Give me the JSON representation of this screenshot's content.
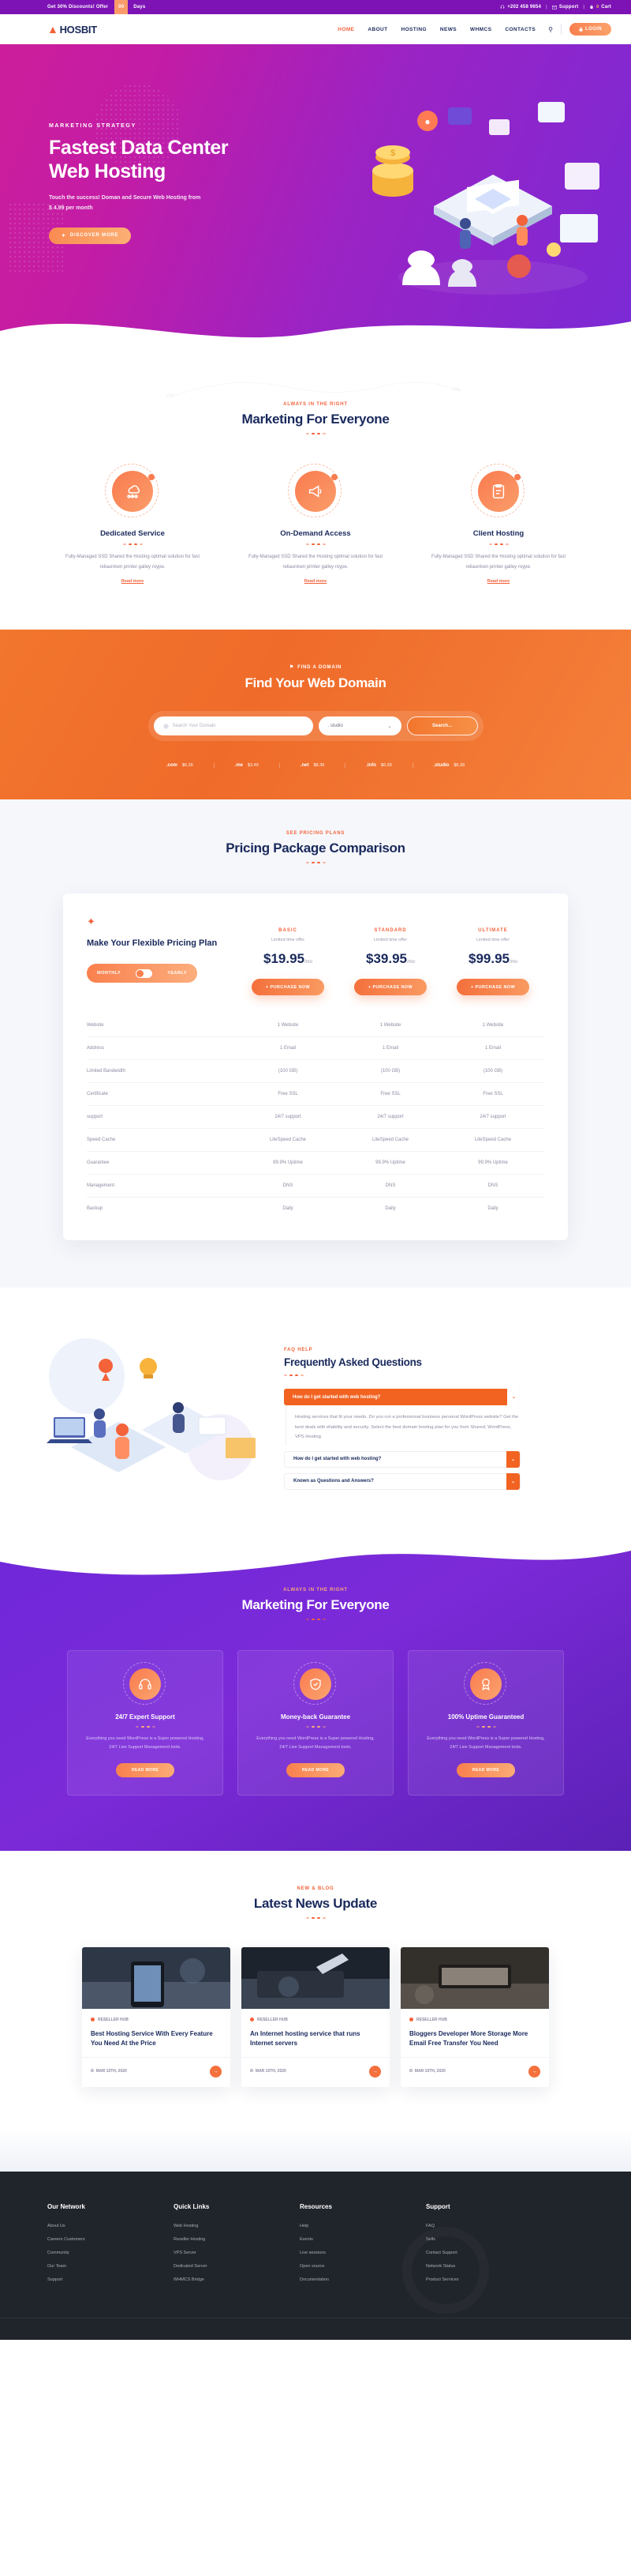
{
  "topbar": {
    "offer_text": "Get 30% Discounts! Offer",
    "counter": "00",
    "days_label": "Days",
    "phone": "+202 458 9654",
    "support": "Support",
    "cart": "Cart",
    "cart_count": "0",
    "bg_color": "#7d13b5",
    "counter_color": "#fb9b6a"
  },
  "nav": {
    "logo": "HOSBIT",
    "items": [
      {
        "label": "HOME",
        "active": true
      },
      {
        "label": "ABOUT",
        "active": false
      },
      {
        "label": "HOSTING",
        "active": false
      },
      {
        "label": "NEWS",
        "active": false
      },
      {
        "label": "WHMCS",
        "active": false
      },
      {
        "label": "CONTACTS",
        "active": false
      }
    ],
    "login_label": "LOGIN",
    "accent_color": "#f4623a"
  },
  "hero": {
    "eyebrow": "MARKETING STRATEGY",
    "title_line1": "Fastest Data Center",
    "title_line2": "Web Hosting",
    "sub_line1": "Touch the success! Doman and Secure Web Hosting from",
    "sub_line2": "$ 4.99 per month",
    "cta": "DISCOVER MORE"
  },
  "services": {
    "eyebrow": "ALWAYS IN THE RIGHT",
    "title": "Marketing For Everyone",
    "items": [
      {
        "icon": "cloud-network-icon",
        "title": "Dedicated Service",
        "desc": "Fully-Managed SSD Shared the Hosting optimal solution for fast reliaunkwn printer galley roype.",
        "link": "Read more"
      },
      {
        "icon": "megaphone-icon",
        "title": "On-Demand Access",
        "desc": "Fully-Managed SSD Shared the Hosting optimal solution for fast reliaunkwn printer galley roype.",
        "link": "Read more"
      },
      {
        "icon": "clipboard-icon",
        "title": "Client Hosting",
        "desc": "Fully-Managed SSD Shared the Hosting optimal solution for fast reliaunkwn printer galley roype.",
        "link": "Read more"
      }
    ]
  },
  "domain": {
    "eyebrow": "FIND A DOMAIN",
    "title": "Find Your Web Domain",
    "search_placeholder": "Search Your Domain",
    "tld_selected": ". studio",
    "search_button": "Search...",
    "tlds": [
      {
        "name": ".com",
        "price": "$6.39"
      },
      {
        "name": ".me",
        "price": "$3.49"
      },
      {
        "name": ".net",
        "price": "$8.39"
      },
      {
        "name": ".info",
        "price": "$6.39"
      },
      {
        "name": ".studio",
        "price": "$6.39"
      }
    ]
  },
  "pricing": {
    "eyebrow": "SEE PRICING PLANS",
    "title": "Pricing Package Comparison",
    "headline": "Make Your Flexible Pricing Plan",
    "toggle_left": "MONTHLY",
    "toggle_right": "YEARLY",
    "plans": [
      {
        "name": "BASIC",
        "limit": "Limited time offer",
        "price": "$19.95",
        "period": "/mo",
        "cta": "+ PURCHASE NOW"
      },
      {
        "name": "STANDARD",
        "limit": "Limited time offer",
        "price": "$39.95",
        "period": "/mo",
        "cta": "+ PURCHASE NOW"
      },
      {
        "name": "ULTIMATE",
        "limit": "Limited time offer",
        "price": "$99.95",
        "period": "/mo",
        "cta": "+ PURCHASE NOW"
      }
    ],
    "features": [
      {
        "label": "Website",
        "values": [
          "1 Website",
          "1 Website",
          "1 Website"
        ]
      },
      {
        "label": "Address",
        "values": [
          "1 Email",
          "1 Email",
          "1 Email"
        ]
      },
      {
        "label": "Limited Bandwidth",
        "values": [
          "(100 GB)",
          "(100 GB)",
          "(100 GB)"
        ]
      },
      {
        "label": "Certificate",
        "values": [
          "Free SSL",
          "Free SSL",
          "Free SSL"
        ]
      },
      {
        "label": "support",
        "values": [
          "24/7 support",
          "24/7 support",
          "24/7 support"
        ]
      },
      {
        "label": "Speed Cache",
        "values": [
          "LiteSpeed Cache",
          "LiteSpeed Cache",
          "LiteSpeed Cache"
        ]
      },
      {
        "label": "Guarantee",
        "values": [
          "99.9% Uptime",
          "99.9% Uptime",
          "99.9% Uptime"
        ]
      },
      {
        "label": "Management",
        "values": [
          "DNS",
          "DNS",
          "DNS"
        ]
      },
      {
        "label": "Backup",
        "values": [
          "Daily",
          "Daily",
          "Daily"
        ]
      }
    ]
  },
  "faq": {
    "eyebrow": "FAQ HELP",
    "title": "Frequently Asked Questions",
    "items": [
      {
        "question": "How do I get started with web hosting?",
        "open": true,
        "answer": "Hosting services that fit your needs. Do you run a professional business personal WordPress website? Get the best deals with eliability and security. Select the best domain hosting plan for you from Shared, WordPress, VPS Hosting"
      },
      {
        "question": "How do I get started with web hosting?",
        "open": false,
        "answer": ""
      },
      {
        "question": "Known as Questions and Answers?",
        "open": false,
        "answer": ""
      }
    ]
  },
  "features": {
    "eyebrow": "ALWAYS IN THE RIGHT",
    "title": "Marketing For Everyone",
    "items": [
      {
        "icon": "headset-icon",
        "title": "24/7 Expert Support",
        "desc": "Everything you need WordPress is a Super powered Hosting, 24/7 Live Support Management tools.",
        "cta": "READ MORE"
      },
      {
        "icon": "shield-icon",
        "title": "Money-back Guarantee",
        "desc": "Everything you need WordPress is a Super powered Hosting, 24/7 Live Support Management tools.",
        "cta": "READ MORE"
      },
      {
        "icon": "award-icon",
        "title": "100% Uptime Guaranteed",
        "desc": "Everything you need WordPress is a Super powered Hosting, 24/7 Live Support Management tools.",
        "cta": "READ MORE"
      }
    ]
  },
  "blog": {
    "eyebrow": "NEW & BLOG",
    "title": "Latest News Update",
    "posts": [
      {
        "tag": "RESELLER HUB",
        "title": "Best Hosting Service With Every Feature You Need At the Price",
        "date": "MAR 10TH, 2020"
      },
      {
        "tag": "RESELLER HUB",
        "title": "An Internet hosting service that runs Internet servers",
        "date": "MAR 10TH, 2020"
      },
      {
        "tag": "RESELLER HUB",
        "title": "Bloggers Developer More Storage More Email Free Transfer You Need",
        "date": "MAR 10TH, 2020"
      }
    ]
  },
  "footer": {
    "columns": [
      {
        "title": "Our Network",
        "links": [
          "About Us",
          "Careers Customers",
          "Community",
          "Our Team",
          "Support"
        ]
      },
      {
        "title": "Quick Links",
        "links": [
          "Web Hosting",
          "Reseller Hosting",
          "VPS Server",
          "Dedicated Server",
          "WHMCS Bridge"
        ]
      },
      {
        "title": "Resources",
        "links": [
          "Help",
          "Events",
          "Live sessions",
          "Open source",
          "Documentation"
        ]
      },
      {
        "title": "Support",
        "links": [
          "FAQ",
          "Sells",
          "Contact Support",
          "Network Status",
          "Product Services"
        ]
      }
    ]
  }
}
